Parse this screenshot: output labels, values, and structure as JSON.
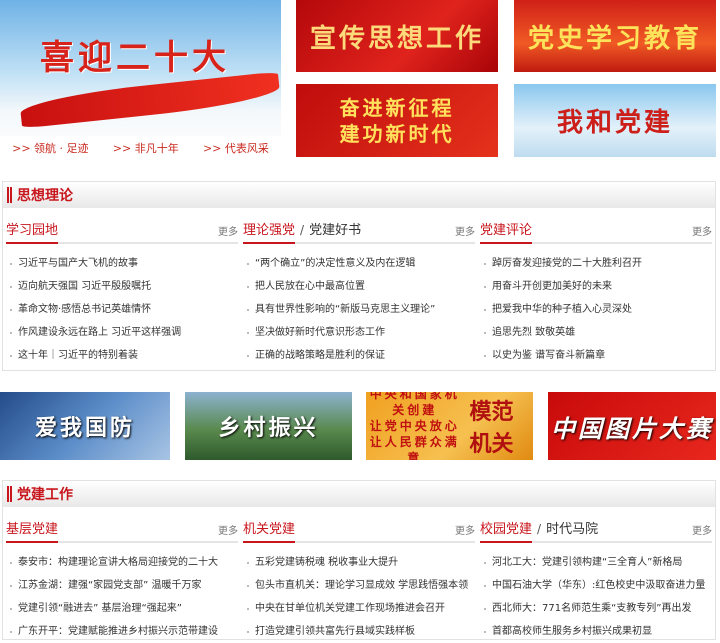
{
  "banners_top": {
    "main": {
      "title": "喜迎二十大",
      "links": [
        ">> 领航 · 足迹",
        ">> 非凡十年",
        ">> 代表风采"
      ]
    },
    "r1": "宣传思想工作",
    "r2": "党史学习教育",
    "r3": [
      "奋进新征程",
      "建功新时代"
    ],
    "r4": "我和党建"
  },
  "sections": [
    {
      "title": "思想理论",
      "columns": [
        {
          "label": "学习园地",
          "more": "更多",
          "items": [
            "习近平与国产大飞机的故事",
            "迈向航天强国 习近平殷殷嘱托",
            "革命文物·感悟总书记英雄情怀",
            "作风建设永远在路上 习近平这样强调",
            "这十年｜习近平的特别着装"
          ]
        },
        {
          "label": "理论强党",
          "sep": "/",
          "label2": "党建好书",
          "more": "更多",
          "items": [
            "“两个确立”的决定性意义及内在逻辑",
            "把人民放在心中最高位置",
            "具有世界性影响的“新版马克思主义理论”",
            "坚决做好新时代意识形态工作",
            "正确的战略策略是胜利的保证"
          ]
        },
        {
          "label": "党建评论",
          "more": "更多",
          "items": [
            "踔厉奋发迎接党的二十大胜利召开",
            "用奋斗开创更加美好的未来",
            "把爱我中华的种子植入心灵深处",
            "追思先烈 致敬英雄",
            "以史为鉴 谱写奋斗新篇章"
          ]
        }
      ]
    },
    {
      "title": "党建工作",
      "columns": [
        {
          "label": "基层党建",
          "more": "更多",
          "items": [
            "泰安市：构建理论宣讲大格局迎接党的二十大",
            "江苏金湖：建强“家园党支部” 温暖千万家",
            "党建引领“融进去” 基层治理“强起来”",
            "广东开平：党建赋能推进乡村振兴示范带建设"
          ]
        },
        {
          "label": "机关党建",
          "more": "更多",
          "items": [
            "五彩党建铸税魂 税收事业大提升",
            "包头市直机关：理论学习显成效 学思践悟强本领",
            "中央在甘单位机关党建工作现场推进会召开",
            "打造党建引领共富先行县域实践样板"
          ]
        },
        {
          "label": "校园党建",
          "sep": "/",
          "label2": "时代马院",
          "more": "更多",
          "items": [
            "河北工大：党建引领构建“三全育人”新格局",
            "中国石油大学（华东）:红色校史中汲取奋进力量",
            "西北师大：771名师范生乘“支教专列”再出发",
            "首都高校师生服务乡村振兴成果初显"
          ]
        }
      ]
    }
  ],
  "banners_mid": {
    "m1": "爱我国防",
    "m2": "乡村振兴",
    "m3": {
      "top": "中央和国家机关创建",
      "line1": "让党中央放心",
      "line2": "让人民群众满意",
      "side": "模范机关"
    },
    "m4": "中国图片大赛"
  }
}
